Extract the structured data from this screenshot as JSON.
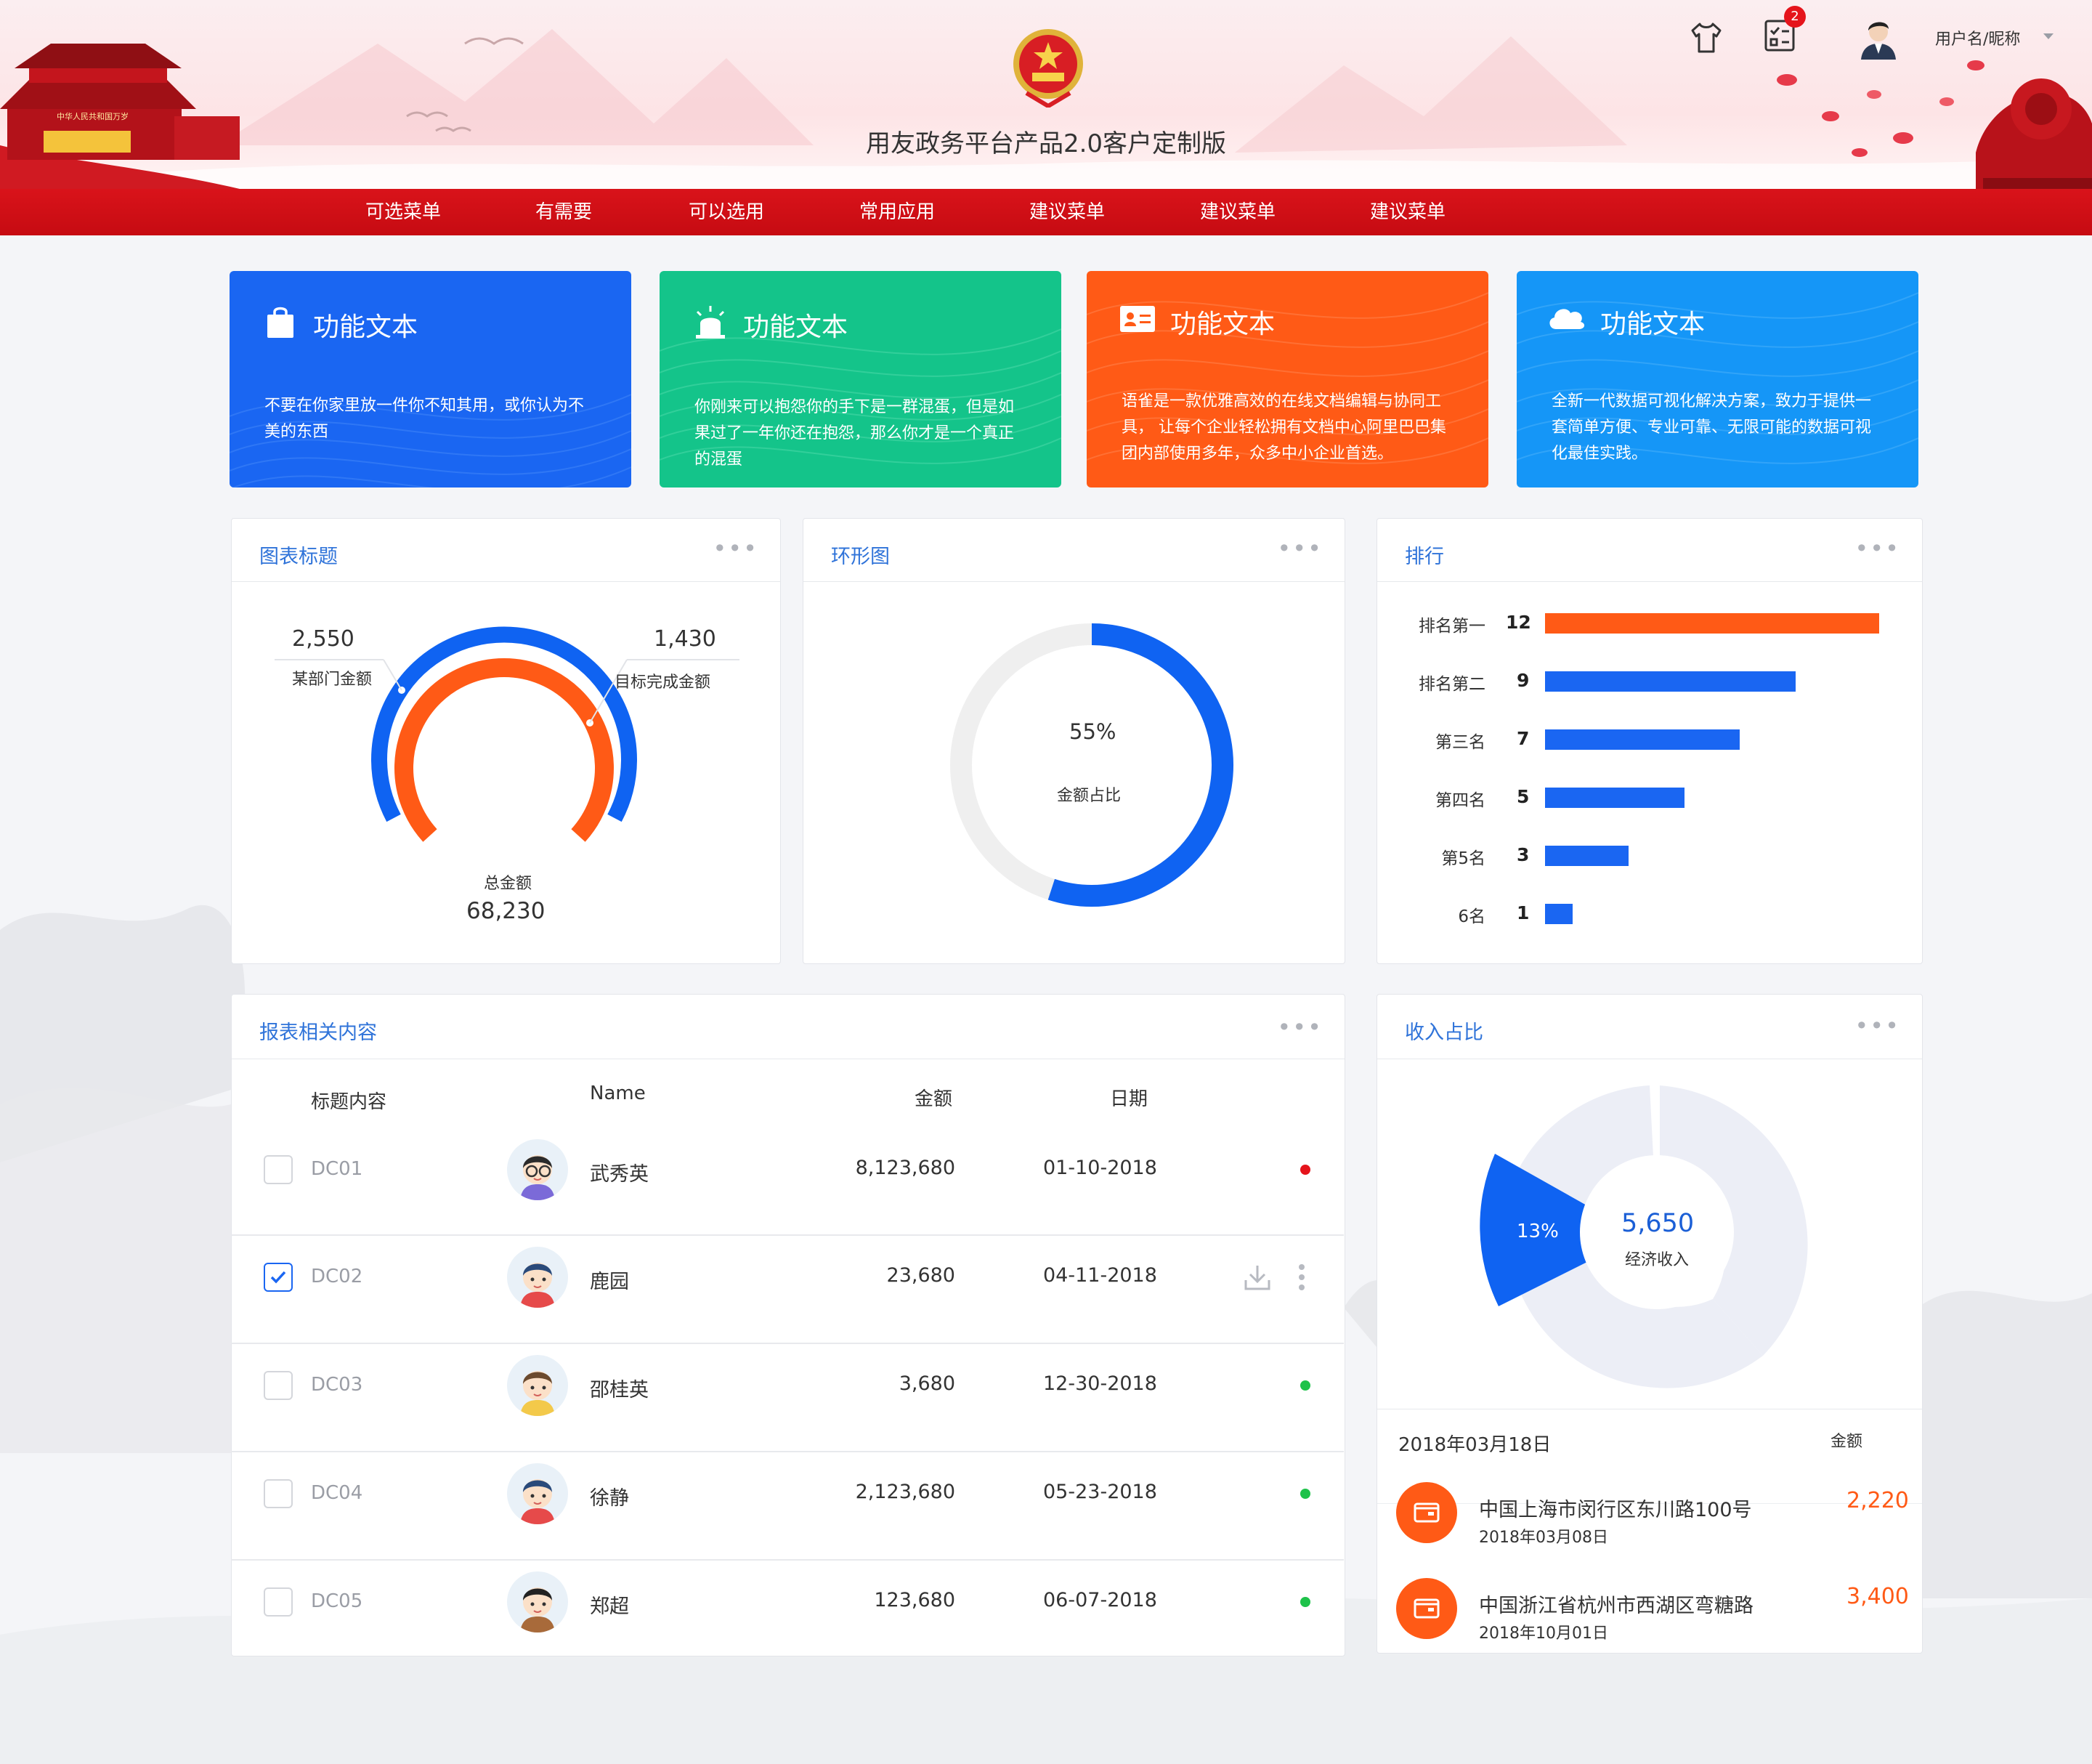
{
  "header": {
    "title": "用友政务平台产品2.0客户定制版",
    "username": "用户名/昵称",
    "notification_count": "2",
    "gate_banner": "中华人民共和国万岁"
  },
  "nav": {
    "items": [
      "可选菜单",
      "有需要",
      "可以选用",
      "常用应用",
      "建议菜单",
      "建议菜单",
      "建议菜单"
    ]
  },
  "feature_cards": [
    {
      "title": "功能文本",
      "desc": "不要在你家里放一件你不知其用，或你认为不美的东西",
      "color": "#1a66f2",
      "icon": "shopping-bag-icon"
    },
    {
      "title": "功能文本",
      "desc": "你刚来可以抱怨你的手下是一群混蛋，但是如果过了一年你还在抱怨，那么你才是一个真正的混蛋",
      "color": "#14c48a",
      "icon": "alarm-light-icon"
    },
    {
      "title": "功能文本",
      "desc": "语雀是一款优雅高效的在线文档编辑与协同工具， 让每个企业轻松拥有文档中心阿里巴巴集团内部使用多年，众多中小企业首选。",
      "color": "#ff5a16",
      "icon": "id-card-icon"
    },
    {
      "title": "功能文本",
      "desc": "全新一代数据可视化解决方案，致力于提供一套简单方便、专业可靠、无限可能的数据可视化最佳实践。",
      "color": "#1596f7",
      "icon": "cloud-icon"
    }
  ],
  "gauge_panel": {
    "title": "图表标题",
    "left_value": "2,550",
    "left_label": "某部门金额",
    "right_value": "1,430",
    "right_label": "目标完成金额",
    "total_label": "总金额",
    "total_value": "68,230"
  },
  "ring_panel": {
    "title": "环形图",
    "percent": "55%",
    "label": "金额占比",
    "fraction": 0.55
  },
  "rank_panel": {
    "title": "排行",
    "max": 12,
    "items": [
      {
        "label": "排名第一",
        "value": 12,
        "value_text": "12"
      },
      {
        "label": "排名第二",
        "value": 9,
        "value_text": "9"
      },
      {
        "label": "第三名",
        "value": 7,
        "value_text": "7"
      },
      {
        "label": "第四名",
        "value": 5,
        "value_text": "5"
      },
      {
        "label": "第5名",
        "value": 3,
        "value_text": "3"
      },
      {
        "label": "6名",
        "value": 1,
        "value_text": "1"
      }
    ]
  },
  "table_panel": {
    "title": "报表相关内容",
    "headers": {
      "title": "标题内容",
      "name": "Name",
      "amount": "金额",
      "date": "日期"
    },
    "rows": [
      {
        "code": "DC01",
        "name": "武秀英",
        "amount": "8,123,680",
        "date": "01-10-2018",
        "checked": false,
        "status": "red"
      },
      {
        "code": "DC02",
        "name": "鹿园",
        "amount": "23,680",
        "date": "04-11-2018",
        "checked": true,
        "status": "actions"
      },
      {
        "code": "DC03",
        "name": "邵桂英",
        "amount": "3,680",
        "date": "12-30-2018",
        "checked": false,
        "status": "green"
      },
      {
        "code": "DC04",
        "name": "徐静",
        "amount": "2,123,680",
        "date": "05-23-2018",
        "checked": false,
        "status": "green"
      },
      {
        "code": "DC05",
        "name": "郑超",
        "amount": "123,680",
        "date": "06-07-2018",
        "checked": false,
        "status": "green"
      }
    ]
  },
  "income_panel": {
    "title": "收入占比",
    "center_value": "5,650",
    "center_label": "经济收入",
    "highlight_percent": "13%",
    "date_header": "2018年03月18日",
    "amount_header": "金额",
    "entries": [
      {
        "address": "中国上海市闵行区东川路100号",
        "date": "2018年03月08日",
        "amount": "2,220"
      },
      {
        "address": "中国浙江省杭州市西湖区弯糖路",
        "date": "2018年10月01日",
        "amount": "3,400"
      }
    ]
  },
  "colors": {
    "accent_blue": "#1a66f2",
    "orange": "#ff5a16",
    "nav_red": "#d9131a",
    "title_blue": "#2f73d9"
  }
}
